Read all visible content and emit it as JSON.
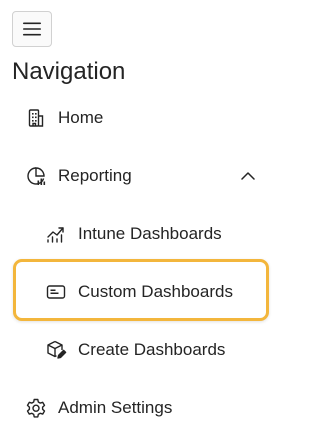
{
  "menu_button": {
    "icon": "hamburger-icon"
  },
  "nav": {
    "title": "Navigation",
    "items": [
      {
        "label": "Home",
        "icon": "building-icon"
      },
      {
        "label": "Reporting",
        "icon": "report-gauge-icon",
        "expanded": true,
        "chevron": "chevron-up-icon"
      },
      {
        "label": "Intune Dashboards",
        "icon": "trend-chart-icon"
      },
      {
        "label": "Custom Dashboards",
        "icon": "dashboard-card-icon",
        "highlighted": true
      },
      {
        "label": "Create Dashboards",
        "icon": "cube-edit-icon"
      },
      {
        "label": "Admin Settings",
        "icon": "gear-icon"
      }
    ]
  },
  "colors": {
    "highlight_border": "#f3b63c",
    "text": "#242424"
  }
}
